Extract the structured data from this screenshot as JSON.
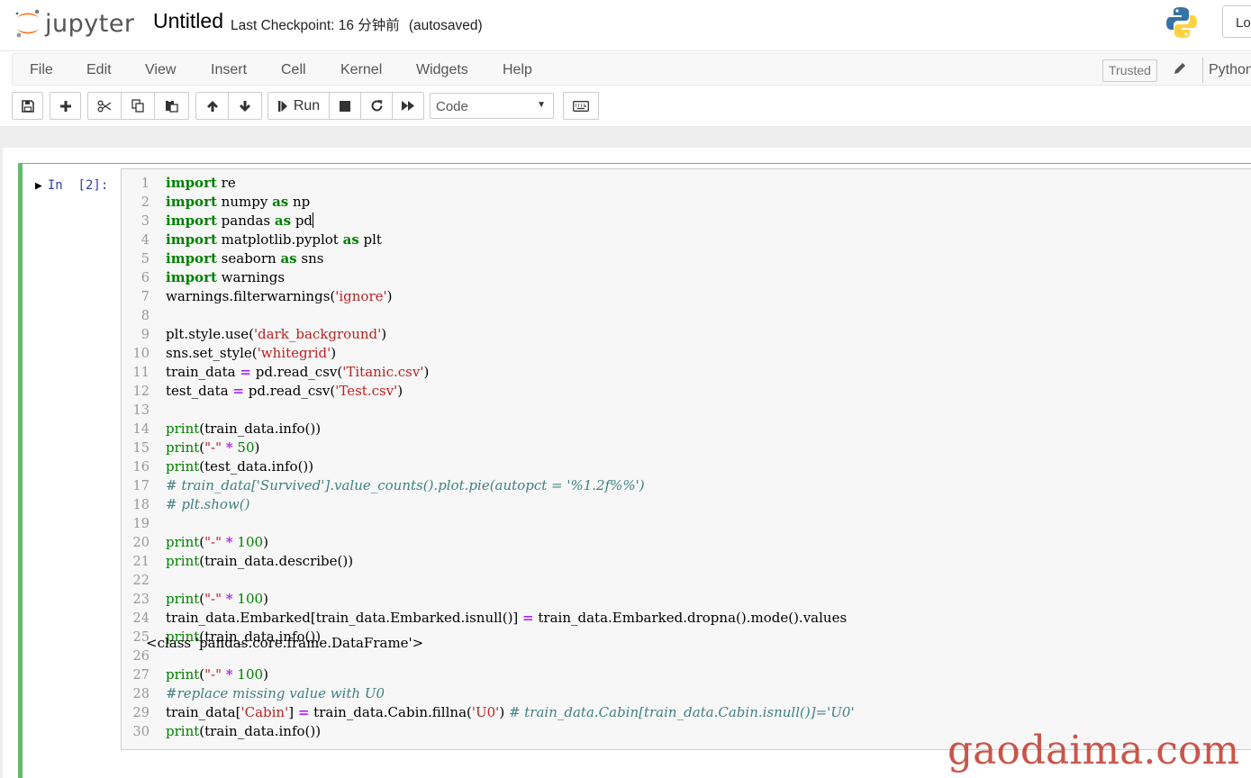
{
  "header": {
    "logo_text": "jupyter",
    "notebook_name": "Untitled",
    "checkpoint": "Last Checkpoint: 16 分钟前",
    "autosave": "(autosaved)",
    "login_label": "Lo"
  },
  "menubar": {
    "items": [
      "File",
      "Edit",
      "View",
      "Insert",
      "Cell",
      "Kernel",
      "Widgets",
      "Help"
    ],
    "trusted_label": "Trusted",
    "kernel_label": "Python"
  },
  "toolbar": {
    "run_label": "Run",
    "cell_type": "Code"
  },
  "cell": {
    "prompt": "In  [2]:",
    "lines": [
      "import re",
      "import numpy as np",
      "import pandas as pd",
      "import matplotlib.pyplot as plt",
      "import seaborn as sns",
      "import warnings",
      "warnings.filterwarnings('ignore')",
      "",
      "plt.style.use('dark_background')",
      "sns.set_style('whitegrid')",
      "train_data = pd.read_csv('Titanic.csv')",
      "test_data = pd.read_csv('Test.csv')",
      "",
      "print(train_data.info())",
      "print(\"-\" * 50)",
      "print(test_data.info())",
      "# train_data['Survived'].value_counts().plot.pie(autopct = '%1.2f%%')",
      "# plt.show()",
      "",
      "print(\"-\" * 100)",
      "print(train_data.describe())",
      "",
      "print(\"-\" * 100)",
      "train_data.Embarked[train_data.Embarked.isnull()] = train_data.Embarked.dropna().mode().values",
      "print(train_data.info())",
      "",
      "print(\"-\" * 100)",
      "#replace missing value with U0",
      "train_data['Cabin'] = train_data.Cabin.fillna('U0') # train_data.Cabin[train_data.Cabin.isnull()]='U0'",
      "print(train_data.info())"
    ],
    "output": "<class 'pandas.core.frame.DataFrame'>"
  },
  "watermark": "gaodaima.com",
  "colors": {
    "cell_border": "#66bb6a",
    "keyword": "#008000",
    "string": "#ba2121",
    "comment": "#408080",
    "operator": "#aa22ff",
    "prompt": "#303f9f"
  },
  "icons": [
    "jupyter-logo-icon",
    "python-logo-icon",
    "pencil-icon",
    "save-icon",
    "plus-icon",
    "cut-icon",
    "copy-icon",
    "paste-icon",
    "arrow-up-icon",
    "arrow-down-icon",
    "step-forward-icon",
    "stop-icon",
    "restart-icon",
    "fast-forward-icon",
    "keyboard-icon"
  ]
}
